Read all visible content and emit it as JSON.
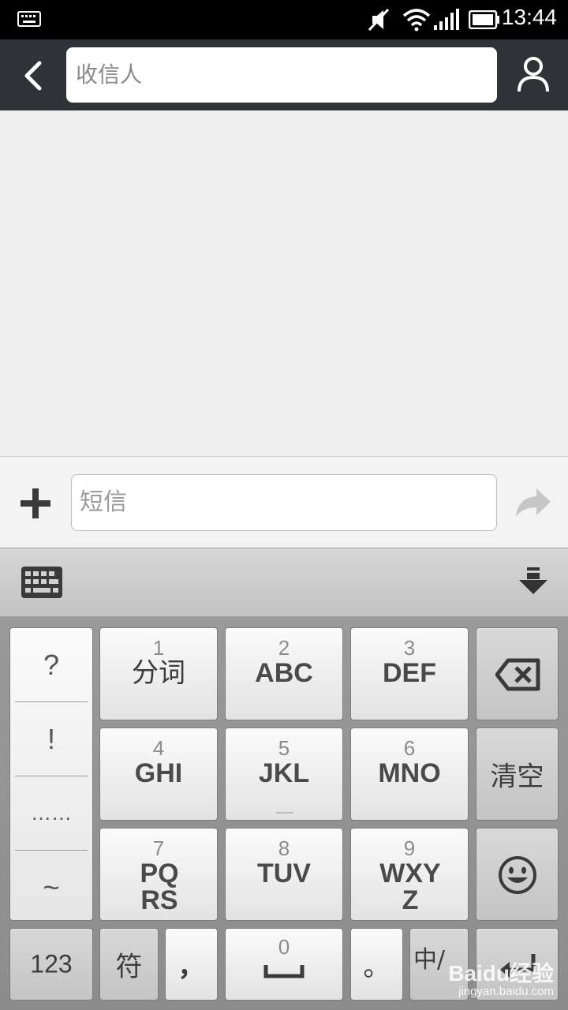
{
  "status_bar": {
    "time": "13:44"
  },
  "header": {
    "recipient_placeholder": "收信人"
  },
  "compose": {
    "sms_placeholder": "短信"
  },
  "keyboard": {
    "symbols": [
      "?",
      "!",
      "……",
      "~"
    ],
    "keys": [
      {
        "digit": "1",
        "label": "分词"
      },
      {
        "digit": "2",
        "label": "ABC"
      },
      {
        "digit": "3",
        "label": "DEF"
      },
      {
        "digit": "4",
        "label": "GHI"
      },
      {
        "digit": "5",
        "label": "JKL"
      },
      {
        "digit": "6",
        "label": "MNO"
      },
      {
        "digit": "7",
        "label": "PQRS"
      },
      {
        "digit": "8",
        "label": "TUV"
      },
      {
        "digit": "9",
        "label": "WXYZ"
      }
    ],
    "clear_label": "清空",
    "num_label": "123",
    "symbol_label": "符",
    "comma_label": "，",
    "space_digit": "0",
    "period_label": "。",
    "lang_label": "中/"
  },
  "watermark": {
    "brand": "Baidu经验",
    "url": "jingyan.baidu.com"
  }
}
